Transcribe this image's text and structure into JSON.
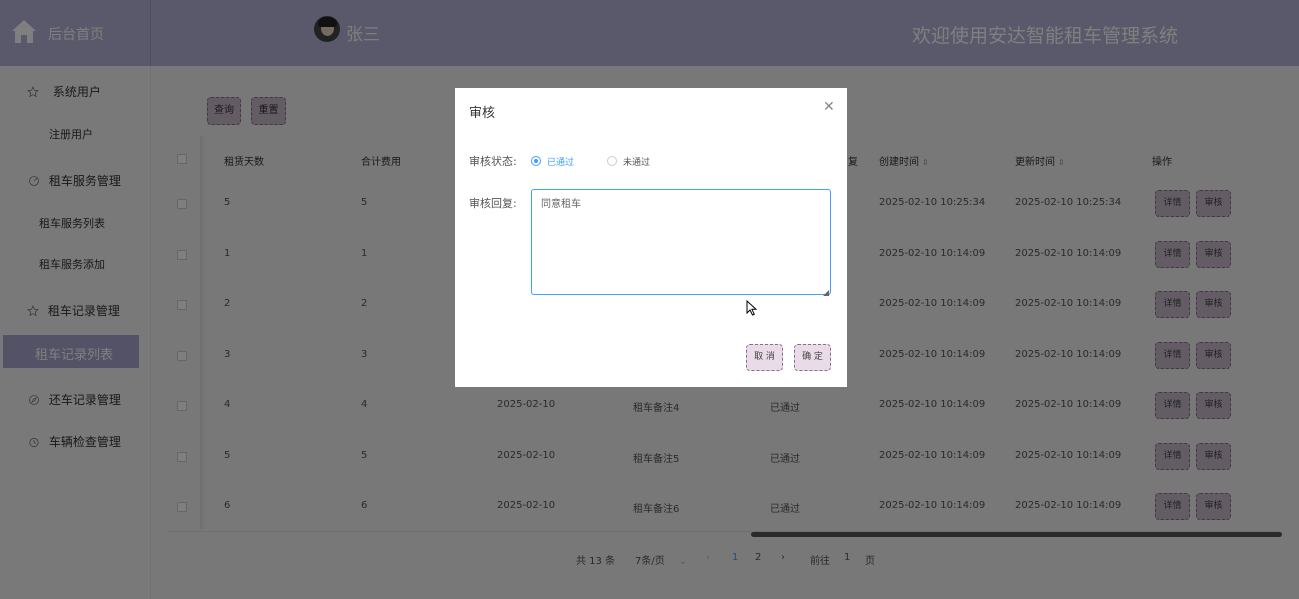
{
  "header": {
    "home_label": "后台首页",
    "user_name": "张三",
    "welcome": "欢迎使用安达智能租车管理系统"
  },
  "sidebar": {
    "items": [
      {
        "label": "系统用户",
        "icon": "star-icon"
      },
      {
        "label": "注册用户"
      },
      {
        "label": "租车服务管理",
        "icon": "circle-icon"
      },
      {
        "label": "租车服务列表"
      },
      {
        "label": "租车服务添加"
      },
      {
        "label": "租车记录管理",
        "icon": "star-icon"
      },
      {
        "label": "租车记录列表",
        "active": true
      },
      {
        "label": "还车记录管理",
        "icon": "compass-icon"
      },
      {
        "label": "车辆检查管理",
        "icon": "clock-icon"
      }
    ]
  },
  "toolbar": {
    "query": "查询",
    "reset": "重置"
  },
  "table": {
    "columns": [
      "租赁天数",
      "合计费用",
      "复",
      "创建时间",
      "更新时间",
      "操作"
    ],
    "rows": [
      {
        "days": "5",
        "total": "5",
        "date": "",
        "remark": "",
        "status": "",
        "created": "2025-02-10 10:25:34",
        "updated": "2025-02-10 10:25:34"
      },
      {
        "days": "1",
        "total": "1",
        "date": "",
        "remark": "",
        "status": "",
        "created": "2025-02-10 10:14:09",
        "updated": "2025-02-10 10:14:09"
      },
      {
        "days": "2",
        "total": "2",
        "date": "",
        "remark": "",
        "status": "",
        "created": "2025-02-10 10:14:09",
        "updated": "2025-02-10 10:14:09"
      },
      {
        "days": "3",
        "total": "3",
        "date": "",
        "remark": "",
        "status": "",
        "created": "2025-02-10 10:14:09",
        "updated": "2025-02-10 10:14:09"
      },
      {
        "days": "4",
        "total": "4",
        "date": "2025-02-10",
        "remark": "租车备注4",
        "status": "已通过",
        "created": "2025-02-10 10:14:09",
        "updated": "2025-02-10 10:14:09"
      },
      {
        "days": "5",
        "total": "5",
        "date": "2025-02-10",
        "remark": "租车备注5",
        "status": "已通过",
        "created": "2025-02-10 10:14:09",
        "updated": "2025-02-10 10:14:09"
      },
      {
        "days": "6",
        "total": "6",
        "date": "2025-02-10",
        "remark": "租车备注6",
        "status": "已通过",
        "created": "2025-02-10 10:14:09",
        "updated": "2025-02-10 10:14:09"
      }
    ],
    "detail_label": "详情",
    "audit_label": "审核"
  },
  "pagination": {
    "total": "共 13 条",
    "page_size": "7条/页",
    "pages": [
      "1",
      "2"
    ],
    "current": "1",
    "goto_prefix": "前往",
    "goto_value": "1",
    "goto_suffix": "页"
  },
  "dialog": {
    "title": "审核",
    "status_label": "审核状态:",
    "option_pass": "已通过",
    "option_fail": "未通过",
    "reply_label": "审核回复:",
    "reply_value": "同意租车",
    "cancel": "取 消",
    "confirm": "确 定"
  },
  "colors": {
    "header": "#b5b0d6",
    "active_nav": "#a9a4cc",
    "accent": "#409eff"
  }
}
